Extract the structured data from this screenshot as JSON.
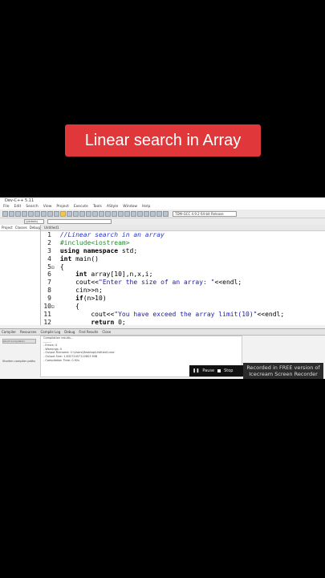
{
  "banner": {
    "title": "Linear search in Array"
  },
  "ide": {
    "window_title": "Dev-C++ 5.11",
    "menu": [
      "File",
      "Edit",
      "Search",
      "View",
      "Project",
      "Execute",
      "Tools",
      "AStyle",
      "Window",
      "Help"
    ],
    "compiler_combo": "TDM-GCC 4.9.2 64-bit Release",
    "globals_combo": "(globals)",
    "panel_tabs": [
      "Project",
      "Classes",
      "Debug"
    ],
    "editor_tab": "Untitled1",
    "code_lines": [
      {
        "n": "1",
        "fold": "",
        "segments": [
          {
            "t": "//Linear search in an array",
            "c": "c-comment"
          }
        ]
      },
      {
        "n": "2",
        "fold": "",
        "segments": [
          {
            "t": "#include<iostream>",
            "c": "c-pre"
          }
        ]
      },
      {
        "n": "3",
        "fold": "",
        "segments": [
          {
            "t": "using namespace",
            "c": "c-kw"
          },
          {
            "t": " std;",
            "c": ""
          }
        ]
      },
      {
        "n": "4",
        "fold": "",
        "segments": [
          {
            "t": "int",
            "c": "c-kw"
          },
          {
            "t": " main()",
            "c": ""
          }
        ]
      },
      {
        "n": "5",
        "fold": "⊟",
        "segments": [
          {
            "t": "{",
            "c": ""
          }
        ]
      },
      {
        "n": "6",
        "fold": "",
        "segments": [
          {
            "t": "    ",
            "c": ""
          },
          {
            "t": "int",
            "c": "c-kw"
          },
          {
            "t": " array[10],n,x,i;",
            "c": ""
          }
        ]
      },
      {
        "n": "7",
        "fold": "",
        "segments": [
          {
            "t": "    cout<<",
            "c": ""
          },
          {
            "t": "\"Enter the size of an array: \"",
            "c": "c-str"
          },
          {
            "t": "<<endl;",
            "c": ""
          }
        ]
      },
      {
        "n": "8",
        "fold": "",
        "segments": [
          {
            "t": "    cin>>n;",
            "c": ""
          }
        ]
      },
      {
        "n": "9",
        "fold": "",
        "segments": [
          {
            "t": "    ",
            "c": ""
          },
          {
            "t": "if",
            "c": "c-kw"
          },
          {
            "t": "(n>10)",
            "c": ""
          }
        ]
      },
      {
        "n": "10",
        "fold": "⊟",
        "segments": [
          {
            "t": "    {",
            "c": ""
          }
        ]
      },
      {
        "n": "11",
        "fold": "",
        "segments": [
          {
            "t": "        cout<<",
            "c": ""
          },
          {
            "t": "\"You have exceed the array limit(10)\"",
            "c": "c-str"
          },
          {
            "t": "<<endl;",
            "c": ""
          }
        ]
      },
      {
        "n": "12",
        "fold": "",
        "segments": [
          {
            "t": "        ",
            "c": ""
          },
          {
            "t": "return",
            "c": "c-kw"
          },
          {
            "t": " 0;",
            "c": ""
          }
        ]
      }
    ],
    "output_tabs": [
      "Compiler",
      "Resources",
      "Compile Log",
      "Debug",
      "Find Results",
      "Close"
    ],
    "abort_button": "Abort Compilation",
    "shorten_paths": "Shorten compiler paths",
    "log_lines": [
      "Compilation results...",
      "--------",
      "- Errors: 0",
      "- Warnings: 0",
      "- Output Filename: C:\\Users\\Desktop\\Untitled1.exe",
      "- Output Size: 1.83272457122803 MiB",
      "- Compilation Time: 0.92s"
    ]
  },
  "recorder": {
    "pause_label": "Pause",
    "stop_label": "Stop",
    "watermark_line1": "Recorded in FREE version of",
    "watermark_line2": "Icecream Screen Recorder"
  }
}
